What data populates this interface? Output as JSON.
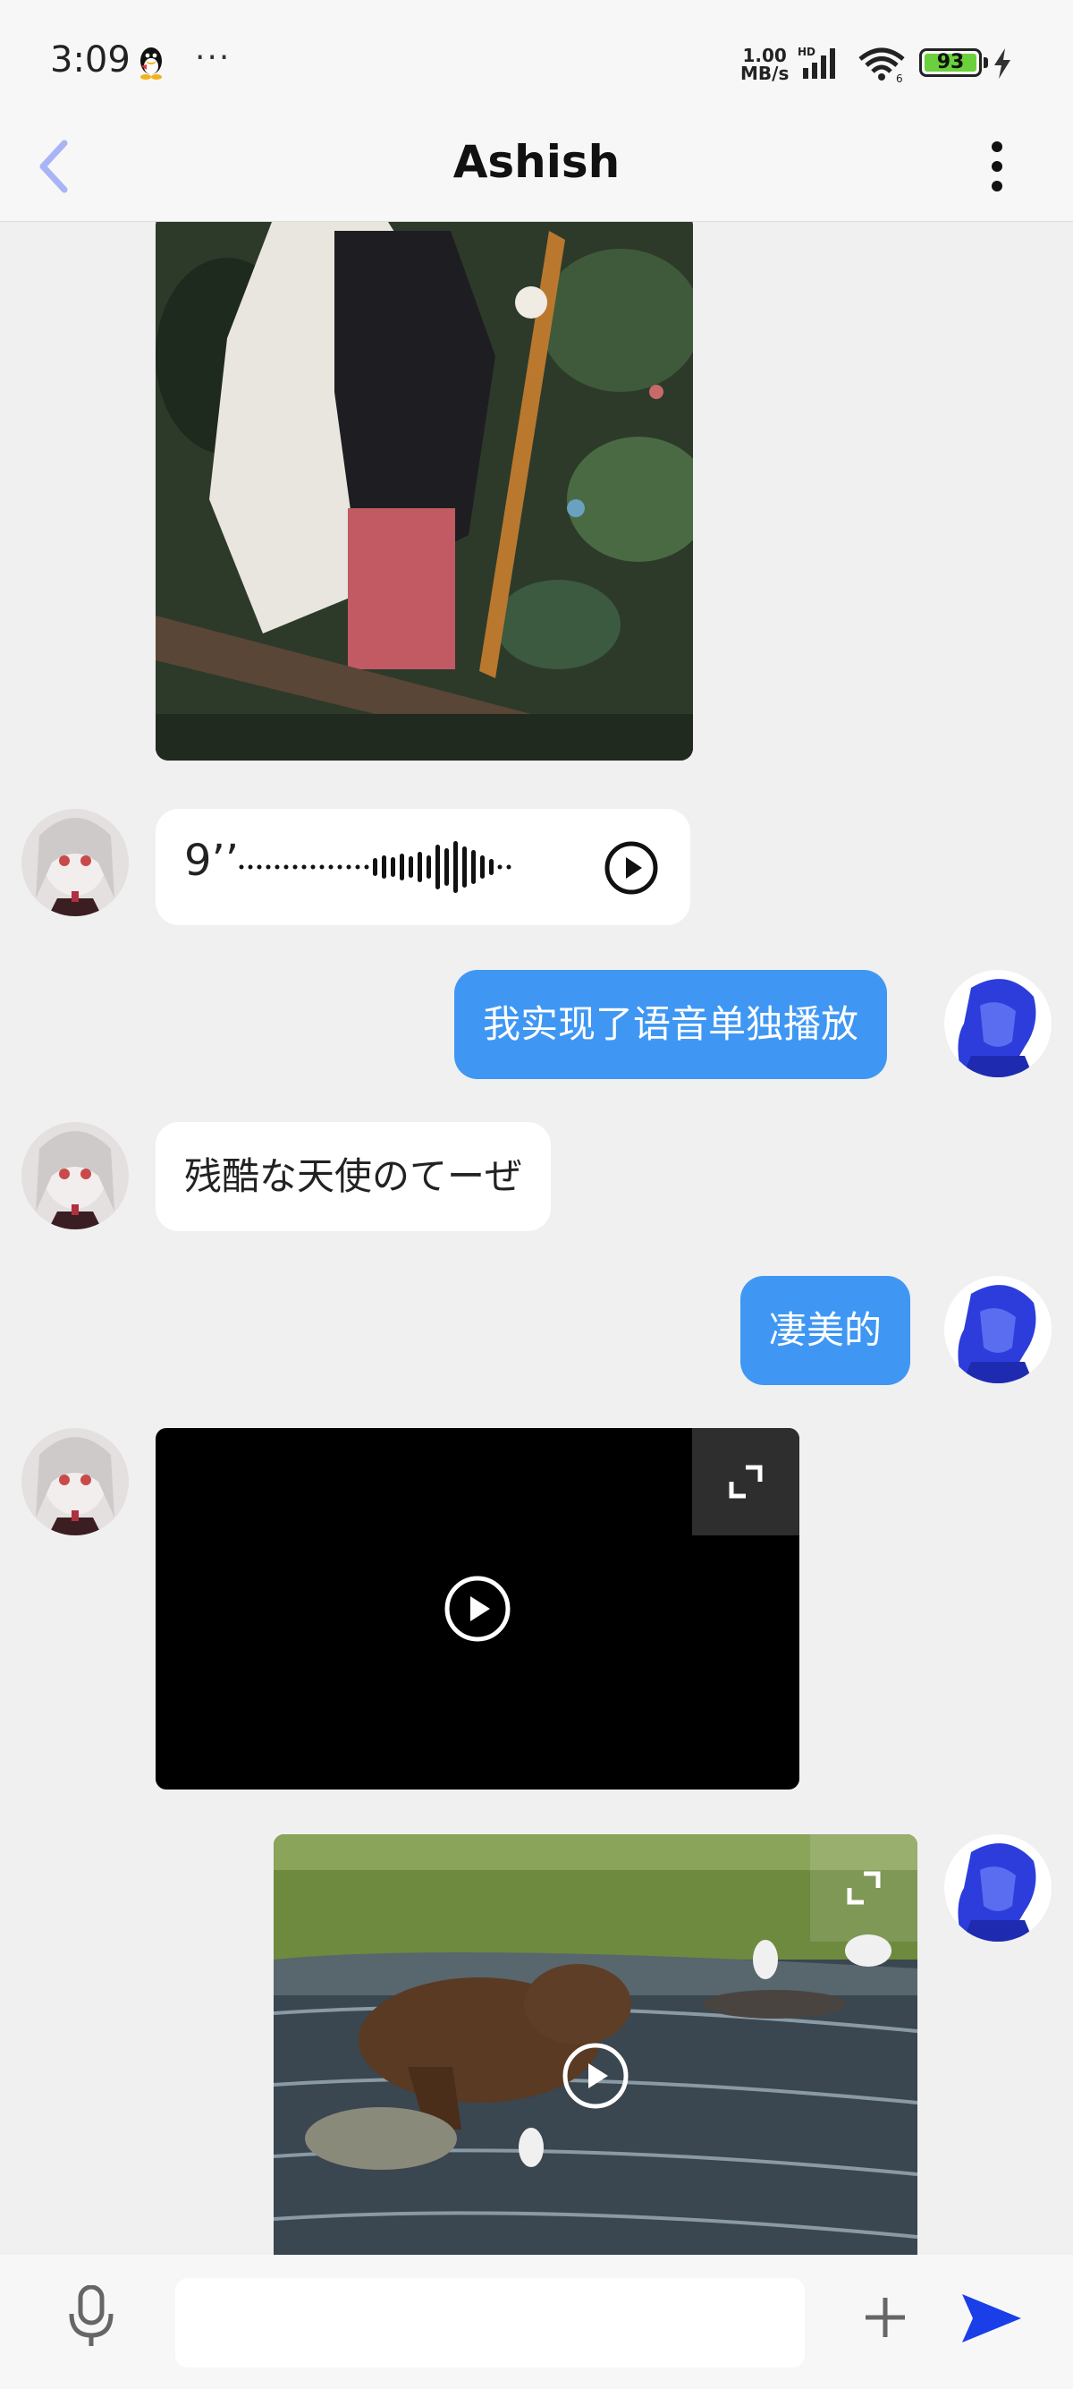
{
  "status_bar": {
    "time": "3:09",
    "more": "···",
    "net_speed_value": "1.00",
    "net_speed_unit": "MB/s",
    "hd": "HD",
    "battery": "93"
  },
  "header": {
    "title": "Ashish"
  },
  "messages": {
    "voice_duration": "9’’",
    "out1": "我实现了语音单独播放",
    "in1": "残酷な天使のてーぜ",
    "out2": "凄美的"
  },
  "input": {
    "placeholder": ""
  },
  "colors": {
    "accent_bubble": "#3f97f3",
    "send_icon": "#1a3ee8",
    "back_icon": "#a8b4f5",
    "battery_fill": "#6ad13c"
  }
}
